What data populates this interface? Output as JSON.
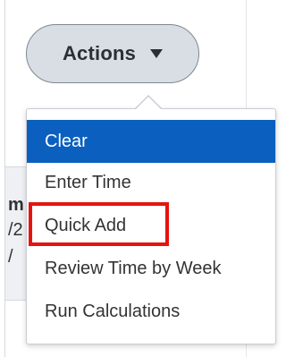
{
  "actions_button": {
    "label": "Actions",
    "icon": "caret-down-icon"
  },
  "menu": {
    "items": [
      {
        "label": "Clear",
        "selected": true
      },
      {
        "label": "Enter Time",
        "selected": false
      },
      {
        "label": "Quick Add",
        "selected": false,
        "highlighted": true
      },
      {
        "label": "Review Time by Week",
        "selected": false
      },
      {
        "label": "Run Calculations",
        "selected": false
      }
    ]
  },
  "background_fragments": [
    "m",
    "/2",
    "/"
  ],
  "colors": {
    "selected_bg": "#0b5fbf",
    "highlight_border": "#e6130f",
    "button_bg": "#d9dee4"
  }
}
